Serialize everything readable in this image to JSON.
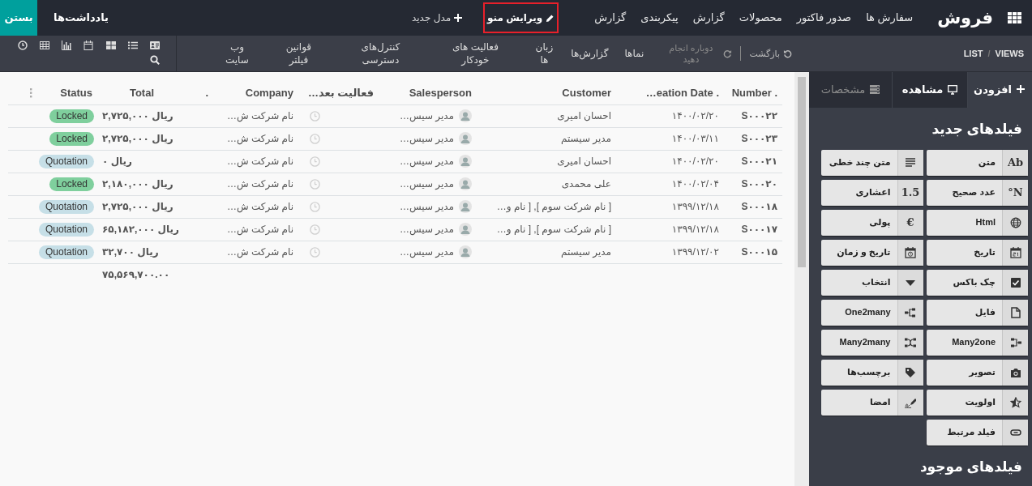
{
  "top_bar": {
    "brand": "فروش",
    "menu": [
      "سفارش ها",
      "صدور فاکتور",
      "محصولات",
      "گزارش",
      "پیکربندی",
      "گزارش"
    ],
    "edit_menu": {
      "label": "ویرایش منو",
      "highlighted": true
    },
    "new_model": "مدل جدید",
    "notes": "یادداشت‌ها",
    "close": "بستن"
  },
  "toolbar": {
    "breadcrumb": [
      "VIEWS",
      "LIST"
    ],
    "breadcrumb_separator": "/",
    "undo": {
      "label": "بازگشت",
      "disabled": false
    },
    "redo": {
      "label": "دوباره انجام دهید",
      "disabled": true
    },
    "tabs": [
      "نماها",
      "گزارش‌ها",
      "زبان ها",
      "فعالیت های خودکار",
      "کنترل‌های دسترسی",
      "قوانین فیلتر",
      "وب سایت"
    ]
  },
  "table": {
    "columns": [
      "Number .",
      "…eation Date .",
      "Customer",
      "Salesperson",
      "فعالیت بعد…",
      "Company",
      ".",
      "Total",
      "Status"
    ],
    "rows": [
      {
        "number": "S۰۰۰۲۲",
        "date": "۱۴۰۰/۰۲/۲۰",
        "customer": "احسان امیری",
        "salesperson": "مدیر سیس…",
        "company": "نام شرکت ش…",
        "total": "۲,۷۲۵,۰۰۰ ریال",
        "status": {
          "label": "Locked",
          "color": "#7fcf9d"
        }
      },
      {
        "number": "S۰۰۰۲۳",
        "date": "۱۴۰۰/۰۳/۱۱",
        "customer": "مدیر سیستم",
        "salesperson": "مدیر سیس…",
        "company": "نام شرکت ش…",
        "total": "۲,۷۲۵,۰۰۰ ریال",
        "status": {
          "label": "Locked",
          "color": "#7fcf9d"
        }
      },
      {
        "number": "S۰۰۰۲۱",
        "date": "۱۴۰۰/۰۲/۲۰",
        "customer": "احسان امیری",
        "salesperson": "مدیر سیس…",
        "company": "نام شرکت ش…",
        "total": "۰ ریال",
        "status": {
          "label": "Quotation",
          "color": "#c6dfe7"
        }
      },
      {
        "number": "S۰۰۰۲۰",
        "date": "۱۴۰۰/۰۲/۰۴",
        "customer": "علی محمدی",
        "salesperson": "مدیر سیس…",
        "company": "نام شرکت ش…",
        "total": "۲,۱۸۰,۰۰۰ ریال",
        "status": {
          "label": "Locked",
          "color": "#7fcf9d"
        }
      },
      {
        "number": "S۰۰۰۱۸",
        "date": "۱۳۹۹/۱۲/۱۸",
        "customer": "[ نام شرکت سوم ], [ نام و…",
        "salesperson": "مدیر سیس…",
        "company": "نام شرکت ش…",
        "total": "۲,۷۲۵,۰۰۰ ریال",
        "status": {
          "label": "Quotation",
          "color": "#c6dfe7"
        }
      },
      {
        "number": "S۰۰۰۱۷",
        "date": "۱۳۹۹/۱۲/۱۸",
        "customer": "[ نام شرکت سوم ], [ نام و…",
        "salesperson": "مدیر سیس…",
        "company": "نام شرکت ش…",
        "total": "۶۵,۱۸۲,۰۰۰ ریال",
        "status": {
          "label": "Quotation",
          "color": "#c6dfe7"
        }
      },
      {
        "number": "S۰۰۰۱۵",
        "date": "۱۳۹۹/۱۲/۰۲",
        "customer": "مدیر سیستم",
        "salesperson": "مدیر سیس…",
        "company": "نام شرکت ش…",
        "total": "۳۲,۷۰۰ ریال",
        "status": {
          "label": "Quotation",
          "color": "#c6dfe7"
        }
      }
    ],
    "footer_total": "۷۵,۵۶۹,۷۰۰.۰۰"
  },
  "sidebar": {
    "tabs": [
      {
        "label": "افزودن",
        "selected": true,
        "disabled": false
      },
      {
        "label": "مشاهده",
        "selected": false,
        "disabled": false
      },
      {
        "label": "مشخصات",
        "selected": false,
        "disabled": true
      }
    ],
    "new_fields_title": "فیلدهای جدید",
    "fields": [
      {
        "label": "متن",
        "kind": "text",
        "glyph": "Ab"
      },
      {
        "label": "متن چند خطی",
        "kind": "multiline"
      },
      {
        "label": "عدد صحیح",
        "kind": "integer",
        "glyph": "N°"
      },
      {
        "label": "اعشاری",
        "kind": "decimal",
        "glyph": "1.5"
      },
      {
        "label": "Html",
        "kind": "html"
      },
      {
        "label": "پولی",
        "kind": "monetary",
        "glyph": "€"
      },
      {
        "label": "تاریخ",
        "kind": "date"
      },
      {
        "label": "تاریخ و زمان",
        "kind": "datetime"
      },
      {
        "label": "چک باکس",
        "kind": "checkbox"
      },
      {
        "label": "انتخاب",
        "kind": "selection"
      },
      {
        "label": "فایل",
        "kind": "file"
      },
      {
        "label": "One2many",
        "kind": "one2many"
      },
      {
        "label": "Many2one",
        "kind": "many2one"
      },
      {
        "label": "Many2many",
        "kind": "many2many"
      },
      {
        "label": "تصویر",
        "kind": "image"
      },
      {
        "label": "برچسب‌ها",
        "kind": "tags"
      },
      {
        "label": "اولویت",
        "kind": "priority"
      },
      {
        "label": "امضا",
        "kind": "signature"
      },
      {
        "label": "فیلد مرتبط",
        "kind": "related"
      }
    ],
    "existing_fields_title": "فیلدهای موجود"
  }
}
